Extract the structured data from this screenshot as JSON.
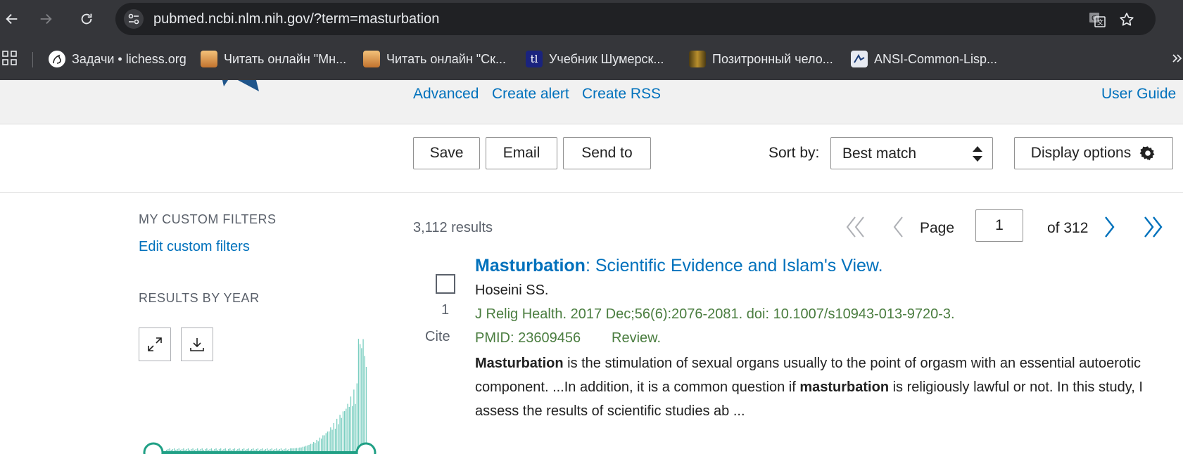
{
  "browser": {
    "url": "pubmed.ncbi.nlm.nih.gov/?term=masturbation",
    "bookmarks": [
      {
        "label": "Задачи • lichess.org",
        "icon": "lichess-icon",
        "color": "#ffffff"
      },
      {
        "label": "Читать онлайн \"Мн...",
        "icon": "book-sunset-icon",
        "color": "#d9a05b"
      },
      {
        "label": "Читать онлайн \"Ск...",
        "icon": "book-sunset-icon",
        "color": "#d9a05b"
      },
      {
        "label": "Учебник Шумерск...",
        "icon": "tl-icon",
        "color": "#1a237e"
      },
      {
        "label": "Позитронный чело...",
        "icon": "book-cover-icon",
        "color": "#7a5c1e"
      },
      {
        "label": "ANSI-Common-Lisp...",
        "icon": "lisp-icon",
        "color": "#ffffff"
      }
    ],
    "overflow_icon": "chevron-double-right-icon"
  },
  "search": {
    "links": [
      "Advanced",
      "Create alert",
      "Create RSS"
    ],
    "user_guide": "User Guide"
  },
  "actions": {
    "save": "Save",
    "email": "Email",
    "send_to": "Send to",
    "sort_label": "Sort by:",
    "sort_value": "Best match",
    "display_options": "Display options"
  },
  "sidebar": {
    "custom_filters_heading": "MY CUSTOM FILTERS",
    "edit_filters": "Edit custom filters",
    "results_by_year_heading": "RESULTS BY YEAR"
  },
  "results": {
    "count": "3,112 results",
    "page_label": "Page",
    "page_value": "1",
    "page_of": "of 312"
  },
  "result_item": {
    "number": "1",
    "cite": "Cite",
    "title_bold": "Masturbation",
    "title_rest": ": Scientific Evidence and Islam's View.",
    "authors": "Hoseini SS.",
    "citation": "J Relig Health. 2017 Dec;56(6):2076-2081. doi: 10.1007/s10943-013-9720-3.",
    "pmid": "PMID: 23609456",
    "pub_type": "Review.",
    "snippet_parts": [
      {
        "bold": true,
        "text": "Masturbation"
      },
      {
        "bold": false,
        "text": " is the stimulation of sexual organs usually to the point of orgasm with an essential autoerotic component. ...In addition, it is a common question if "
      },
      {
        "bold": true,
        "text": "masturbation"
      },
      {
        "bold": false,
        "text": " is religiously lawful or not. In this study, I assess the results of scientific studies ab ..."
      }
    ]
  },
  "colors": {
    "link": "#0071bc",
    "journal": "#4a7d3f",
    "histogram": "#7ccfc1",
    "slider": "#20a085"
  }
}
